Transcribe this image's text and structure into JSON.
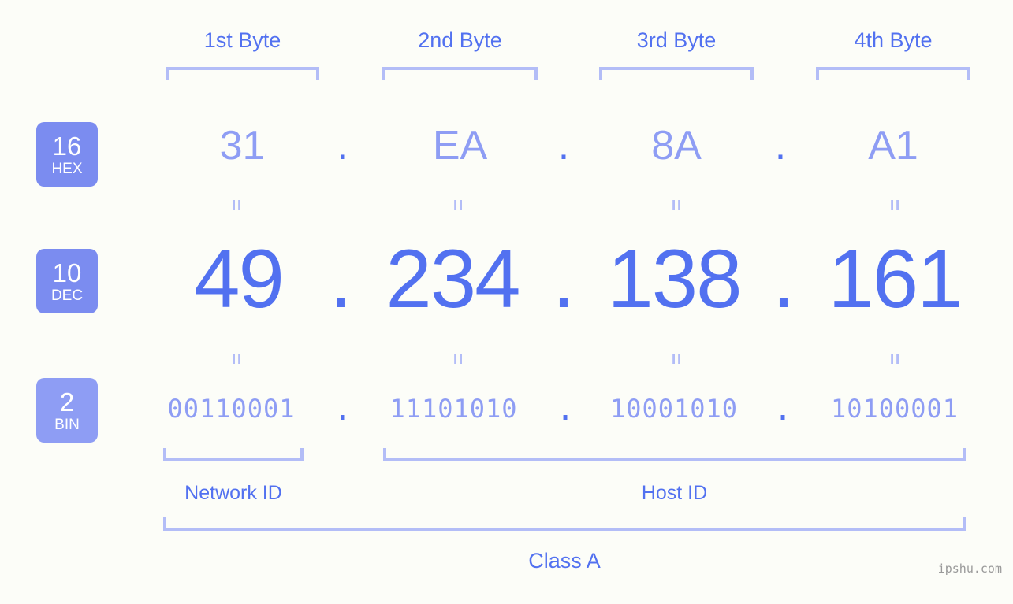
{
  "background_color": "#fcfdf8",
  "colors": {
    "primary_blue": "#5271f0",
    "light_blue": "#8e9df4",
    "bracket_blue": "#b3bdf7",
    "badge_fill": "#7b8cf0",
    "badge_fill_bin": "#8e9df4",
    "watermark_gray": "#9a9a9a"
  },
  "byte_headers": [
    {
      "label": "1st Byte"
    },
    {
      "label": "2nd Byte"
    },
    {
      "label": "3rd Byte"
    },
    {
      "label": "4th Byte"
    }
  ],
  "bases": [
    {
      "number": "16",
      "system": "HEX"
    },
    {
      "number": "10",
      "system": "DEC"
    },
    {
      "number": "2",
      "system": "BIN"
    }
  ],
  "rows": {
    "hex": {
      "octets": [
        "31",
        "EA",
        "8A",
        "A1"
      ],
      "separator": "."
    },
    "dec": {
      "octets": [
        "49",
        "234",
        "138",
        "161"
      ],
      "separator": "."
    },
    "bin": {
      "octets": [
        "00110001",
        "11101010",
        "10001010",
        "10100001"
      ],
      "separator": "."
    }
  },
  "equals_symbol": "=",
  "segments": {
    "network_id": "Network ID",
    "host_id": "Host ID"
  },
  "ip_class": "Class A",
  "watermark": "ipshu.com"
}
